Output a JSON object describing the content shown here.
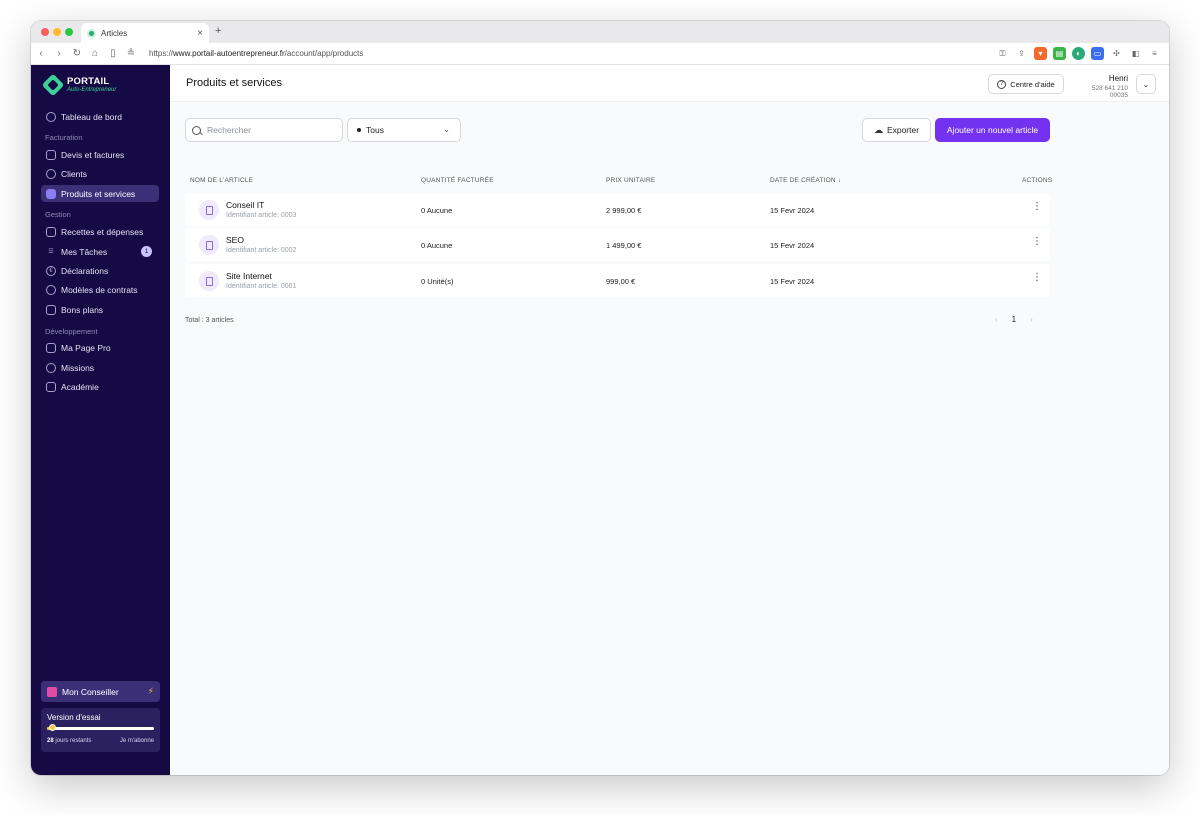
{
  "browser": {
    "tab_title": "Articles",
    "url_prefix": "https://",
    "url_host": "www.portail-autoentrepreneur.fr",
    "url_path": "/account/app/products"
  },
  "sidebar": {
    "logo_title": "PORTAIL",
    "logo_subtitle": "Auto-Entrepreneur",
    "dashboard": "Tableau de bord",
    "sections": {
      "facturation": "Facturation",
      "gestion": "Gestion",
      "developpement": "Développement"
    },
    "items": {
      "devis": "Devis et factures",
      "clients": "Clients",
      "produits": "Produits et services",
      "recettes": "Recettes et dépenses",
      "taches": "Mes Tâches",
      "taches_badge": "1",
      "declarations": "Déclarations",
      "modeles": "Modèles de contrats",
      "bons_plans": "Bons plans",
      "page_pro": "Ma Page Pro",
      "missions": "Missions",
      "academie": "Académie"
    },
    "conseiller": "Mon Conseiller",
    "trial": {
      "title": "Version d'essai",
      "days": "28",
      "days_suffix": " jours restants",
      "subscribe": "Je m'abonne",
      "progress": 0.05
    }
  },
  "header": {
    "title": "Produits et services",
    "help": "Centre d'aide",
    "user_name": "Henri",
    "user_id": "528 641 210 00035"
  },
  "toolbar": {
    "search_placeholder": "Rechercher",
    "filter_value": "Tous",
    "export": "Exporter",
    "add": "Ajouter un nouvel article"
  },
  "table": {
    "headers": {
      "name": "NOM DE L'ARTICLE",
      "qty": "QUANTITÉ FACTURÉE",
      "price": "PRIX UNITAIRE",
      "date": "DATE DE CRÉATION ↓",
      "actions": "ACTIONS"
    },
    "rows": [
      {
        "name": "Conseil IT",
        "ident": "Identifiant article: 0003",
        "qty": "0 Aucune",
        "price": "2 999,00 €",
        "date": "15 Fevr 2024"
      },
      {
        "name": "SEO",
        "ident": "Identifiant article: 0002",
        "qty": "0 Aucune",
        "price": "1 499,00 €",
        "date": "15 Fevr 2024"
      },
      {
        "name": "Site Internet",
        "ident": "Identifiant article: 0001",
        "qty": "0 Unité(s)",
        "price": "999,00 €",
        "date": "15 Fevr 2024"
      }
    ],
    "total": "Total : 3 articles",
    "page": "1"
  }
}
